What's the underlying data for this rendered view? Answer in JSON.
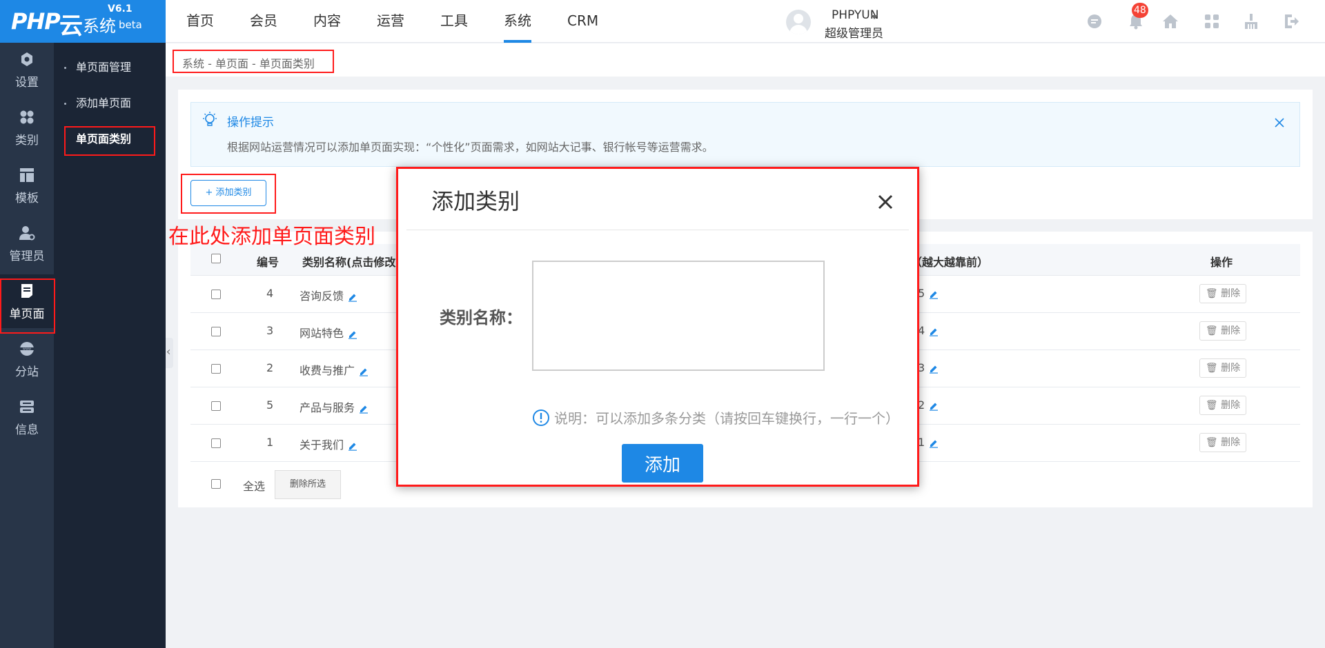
{
  "logo": {
    "brand": "PHP",
    "yun": "云",
    "system": "系统",
    "version": "V6.1",
    "beta": "beta"
  },
  "topnav": [
    {
      "label": "首页"
    },
    {
      "label": "会员"
    },
    {
      "label": "内容"
    },
    {
      "label": "运营"
    },
    {
      "label": "工具"
    },
    {
      "label": "系统",
      "active": true
    },
    {
      "label": "CRM"
    }
  ],
  "user": {
    "name": "PHPYUN",
    "role": "超级管理员",
    "notifications": "48"
  },
  "header_icons": [
    "chat-icon",
    "bell-icon",
    "home-icon",
    "apps-icon",
    "clean-icon",
    "logout-icon"
  ],
  "sidebar": {
    "items": [
      {
        "label": "设置",
        "icon": "settings-icon"
      },
      {
        "label": "类别",
        "icon": "category-icon"
      },
      {
        "label": "模板",
        "icon": "template-icon"
      },
      {
        "label": "管理员",
        "icon": "admin-icon"
      },
      {
        "label": "单页面",
        "icon": "page-icon",
        "active": true
      },
      {
        "label": "分站",
        "icon": "globe-icon"
      },
      {
        "label": "信息",
        "icon": "info-icon"
      }
    ]
  },
  "subnav": {
    "items": [
      {
        "label": "单页面管理"
      },
      {
        "label": "添加单页面"
      },
      {
        "label": "单页面类别",
        "active": true
      }
    ]
  },
  "breadcrumb": "系统 - 单页面 - 单页面类别",
  "tip": {
    "title": "操作提示",
    "text": "根据网站运营情况可以添加单页面实现：“个性化”页面需求，如网站大记事、银行帐号等运营需求。"
  },
  "add_button": "+ 添加类别",
  "annotation": "在此处添加单页面类别",
  "table": {
    "headers": {
      "id": "编号",
      "name": "类别名称(点击修改)",
      "sort": "（越大越靠前）",
      "action": "操作"
    },
    "rows": [
      {
        "id": "4",
        "name": "咨询反馈",
        "sort": "5"
      },
      {
        "id": "3",
        "name": "网站特色",
        "sort": "4"
      },
      {
        "id": "2",
        "name": "收费与推广",
        "sort": "3"
      },
      {
        "id": "5",
        "name": "产品与服务",
        "sort": "2"
      },
      {
        "id": "1",
        "name": "关于我们",
        "sort": "1"
      }
    ],
    "delete_label": "删除",
    "select_all": "全选",
    "delete_selected": "删除所选"
  },
  "modal": {
    "title": "添加类别",
    "label": "类别名称：",
    "note": "说明：可以添加多条分类（请按回车键换行，一行一个）",
    "submit": "添加"
  },
  "colors": {
    "accent": "#1e88e5",
    "sidebar": "#283548",
    "sidebar_dark": "#1b2535",
    "annotation": "#ff1a1a",
    "badge": "#f44336"
  }
}
